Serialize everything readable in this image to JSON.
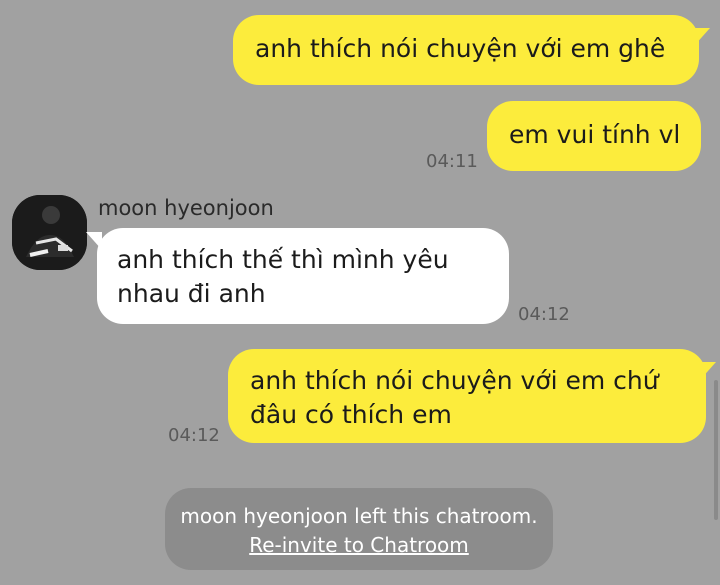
{
  "messages": [
    {
      "from": "me",
      "text": "anh thích nói chuyện với em ghê"
    },
    {
      "from": "me",
      "text": "em vui tính vl",
      "time": "04:11"
    },
    {
      "from": "other",
      "sender": "moon hyeonjoon",
      "lines": [
        "anh thích thế thì mình yêu",
        "nhau đi anh"
      ],
      "time": "04:12"
    },
    {
      "from": "me",
      "lines": [
        "anh thích nói chuyện với em chứ",
        "đâu có thích em"
      ],
      "time": "04:12"
    }
  ],
  "notice": {
    "text": "moon hyeonjoon left this chatroom.",
    "link": "Re-invite to Chatroom"
  },
  "colors": {
    "background": "#a1a1a1",
    "my_bubble": "#fcec3c",
    "other_bubble": "#ffffff",
    "notice_bg": "#8c8c8c"
  }
}
